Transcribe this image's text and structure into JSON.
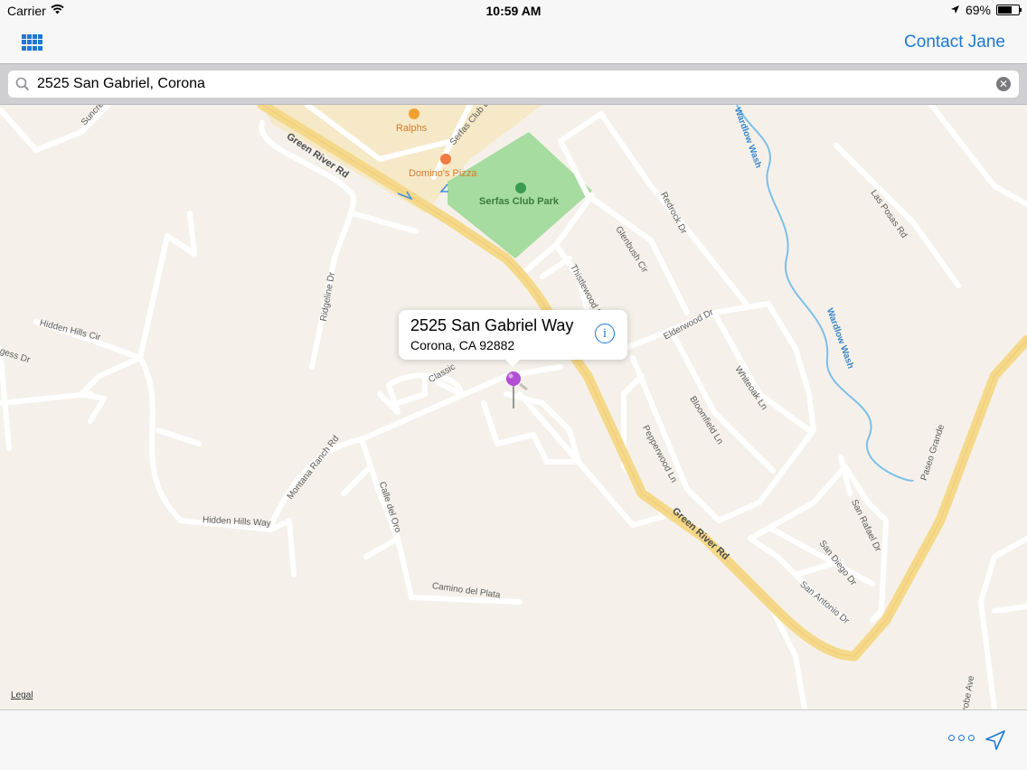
{
  "status_bar": {
    "carrier": "Carrier",
    "time": "10:59 AM",
    "battery": "69%",
    "battery_level": 0.69
  },
  "navbar": {
    "grid_icon": "grid-icon",
    "contact_label": "Contact Jane"
  },
  "search": {
    "value": "2525 San Gabriel, Corona",
    "icon": "search-icon",
    "clear_icon": "clear-icon"
  },
  "map": {
    "labels": {
      "suncrest": "Suncrest",
      "green_river_rd_1": "Green River Rd",
      "green_river_rd_2": "Green River Rd",
      "ralphs": "Ralphs",
      "dominos": "Domino's Pizza",
      "serfas_club_dr": "Serfas Club Dr",
      "serfas_club_park": "Serfas Club Park",
      "redrock_dr": "Redrock Dr",
      "glenbush_cir": "Glenbush Cir",
      "thistlewood_ln": "Thistlewood Ln",
      "las_posas_rd": "Las Posas Rd",
      "wardlow_wash_1": "Wardlow Wash",
      "wardlow_wash_2": "Wardlow Wash",
      "hidden_hills_cir": "Hidden Hills Cir",
      "ridgeline_dr": "Ridgeline Dr",
      "gess_dr": "gess Dr",
      "classic": "Classic",
      "elderwood_dr": "Elderwood Dr",
      "whiteoak_ln": "Whiteoak Ln",
      "bloomfield_ln": "Bloomfield Ln",
      "pepperwood_ln": "Pepperwood Ln",
      "montana_ranch_rd": "Montana Ranch Rd",
      "calle_del_oro": "Calle del Oro",
      "hidden_hills_way": "Hidden Hills Way",
      "camino_del_plata": "Camino del Plata",
      "san_rafael_dr": "San Rafael Dr",
      "san_diego_dr": "San Diego Dr",
      "san_antonio_dr": "San Antonio Dr",
      "paseo_grande": "Paseo Grande",
      "robe_ave": "robe Ave"
    },
    "legal": "Legal"
  },
  "callout": {
    "title": "2525 San Gabriel Way",
    "subtitle": "Corona, CA  92882",
    "info_icon": "info-icon",
    "info_glyph": "i"
  },
  "pin": {
    "color": "#b44ed6",
    "icon": "map-pin-icon"
  },
  "toolbar": {
    "more_icon": "more-icon",
    "location_icon": "location-arrow-icon"
  }
}
